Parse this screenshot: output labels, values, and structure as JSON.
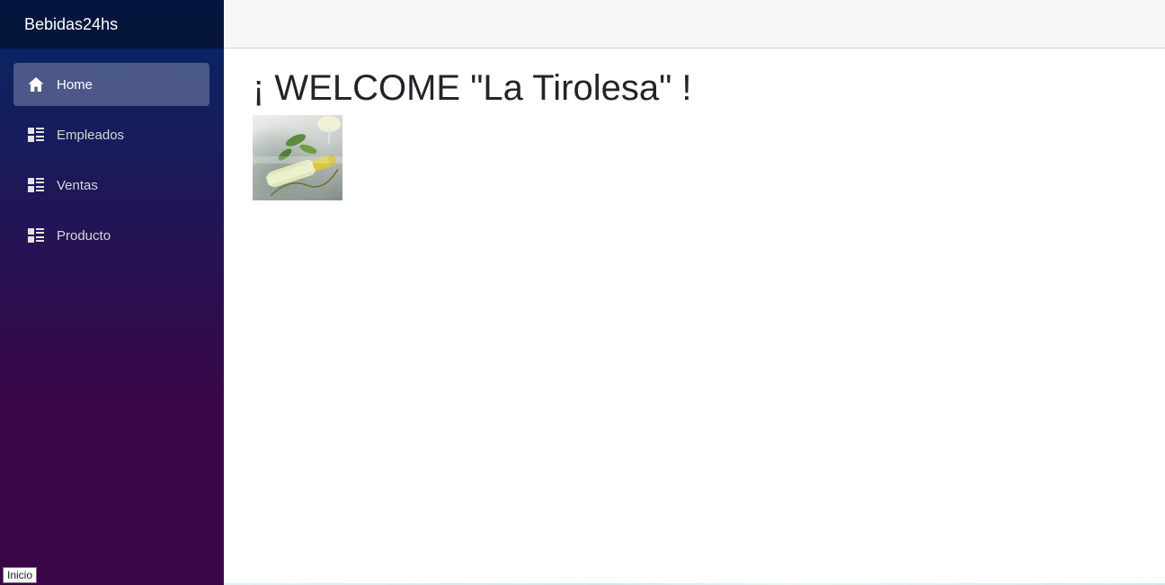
{
  "sidebar": {
    "brand": "Bebidas24hs",
    "items": [
      {
        "label": "Home",
        "icon": "home-icon",
        "active": true
      },
      {
        "label": "Empleados",
        "icon": "list-icon",
        "active": false
      },
      {
        "label": "Ventas",
        "icon": "list-icon",
        "active": false
      },
      {
        "label": "Producto",
        "icon": "list-icon",
        "active": false
      }
    ]
  },
  "main": {
    "title": "¡ WELCOME \"La Tirolesa\" !",
    "image": {
      "description_icon": "wine-bottle-photo"
    }
  },
  "status": {
    "tooltip": "Inicio"
  },
  "colors": {
    "sidebar_top": "#052767",
    "sidebar_bottom": "#3a0647",
    "top_row": "#f7f7f7"
  }
}
